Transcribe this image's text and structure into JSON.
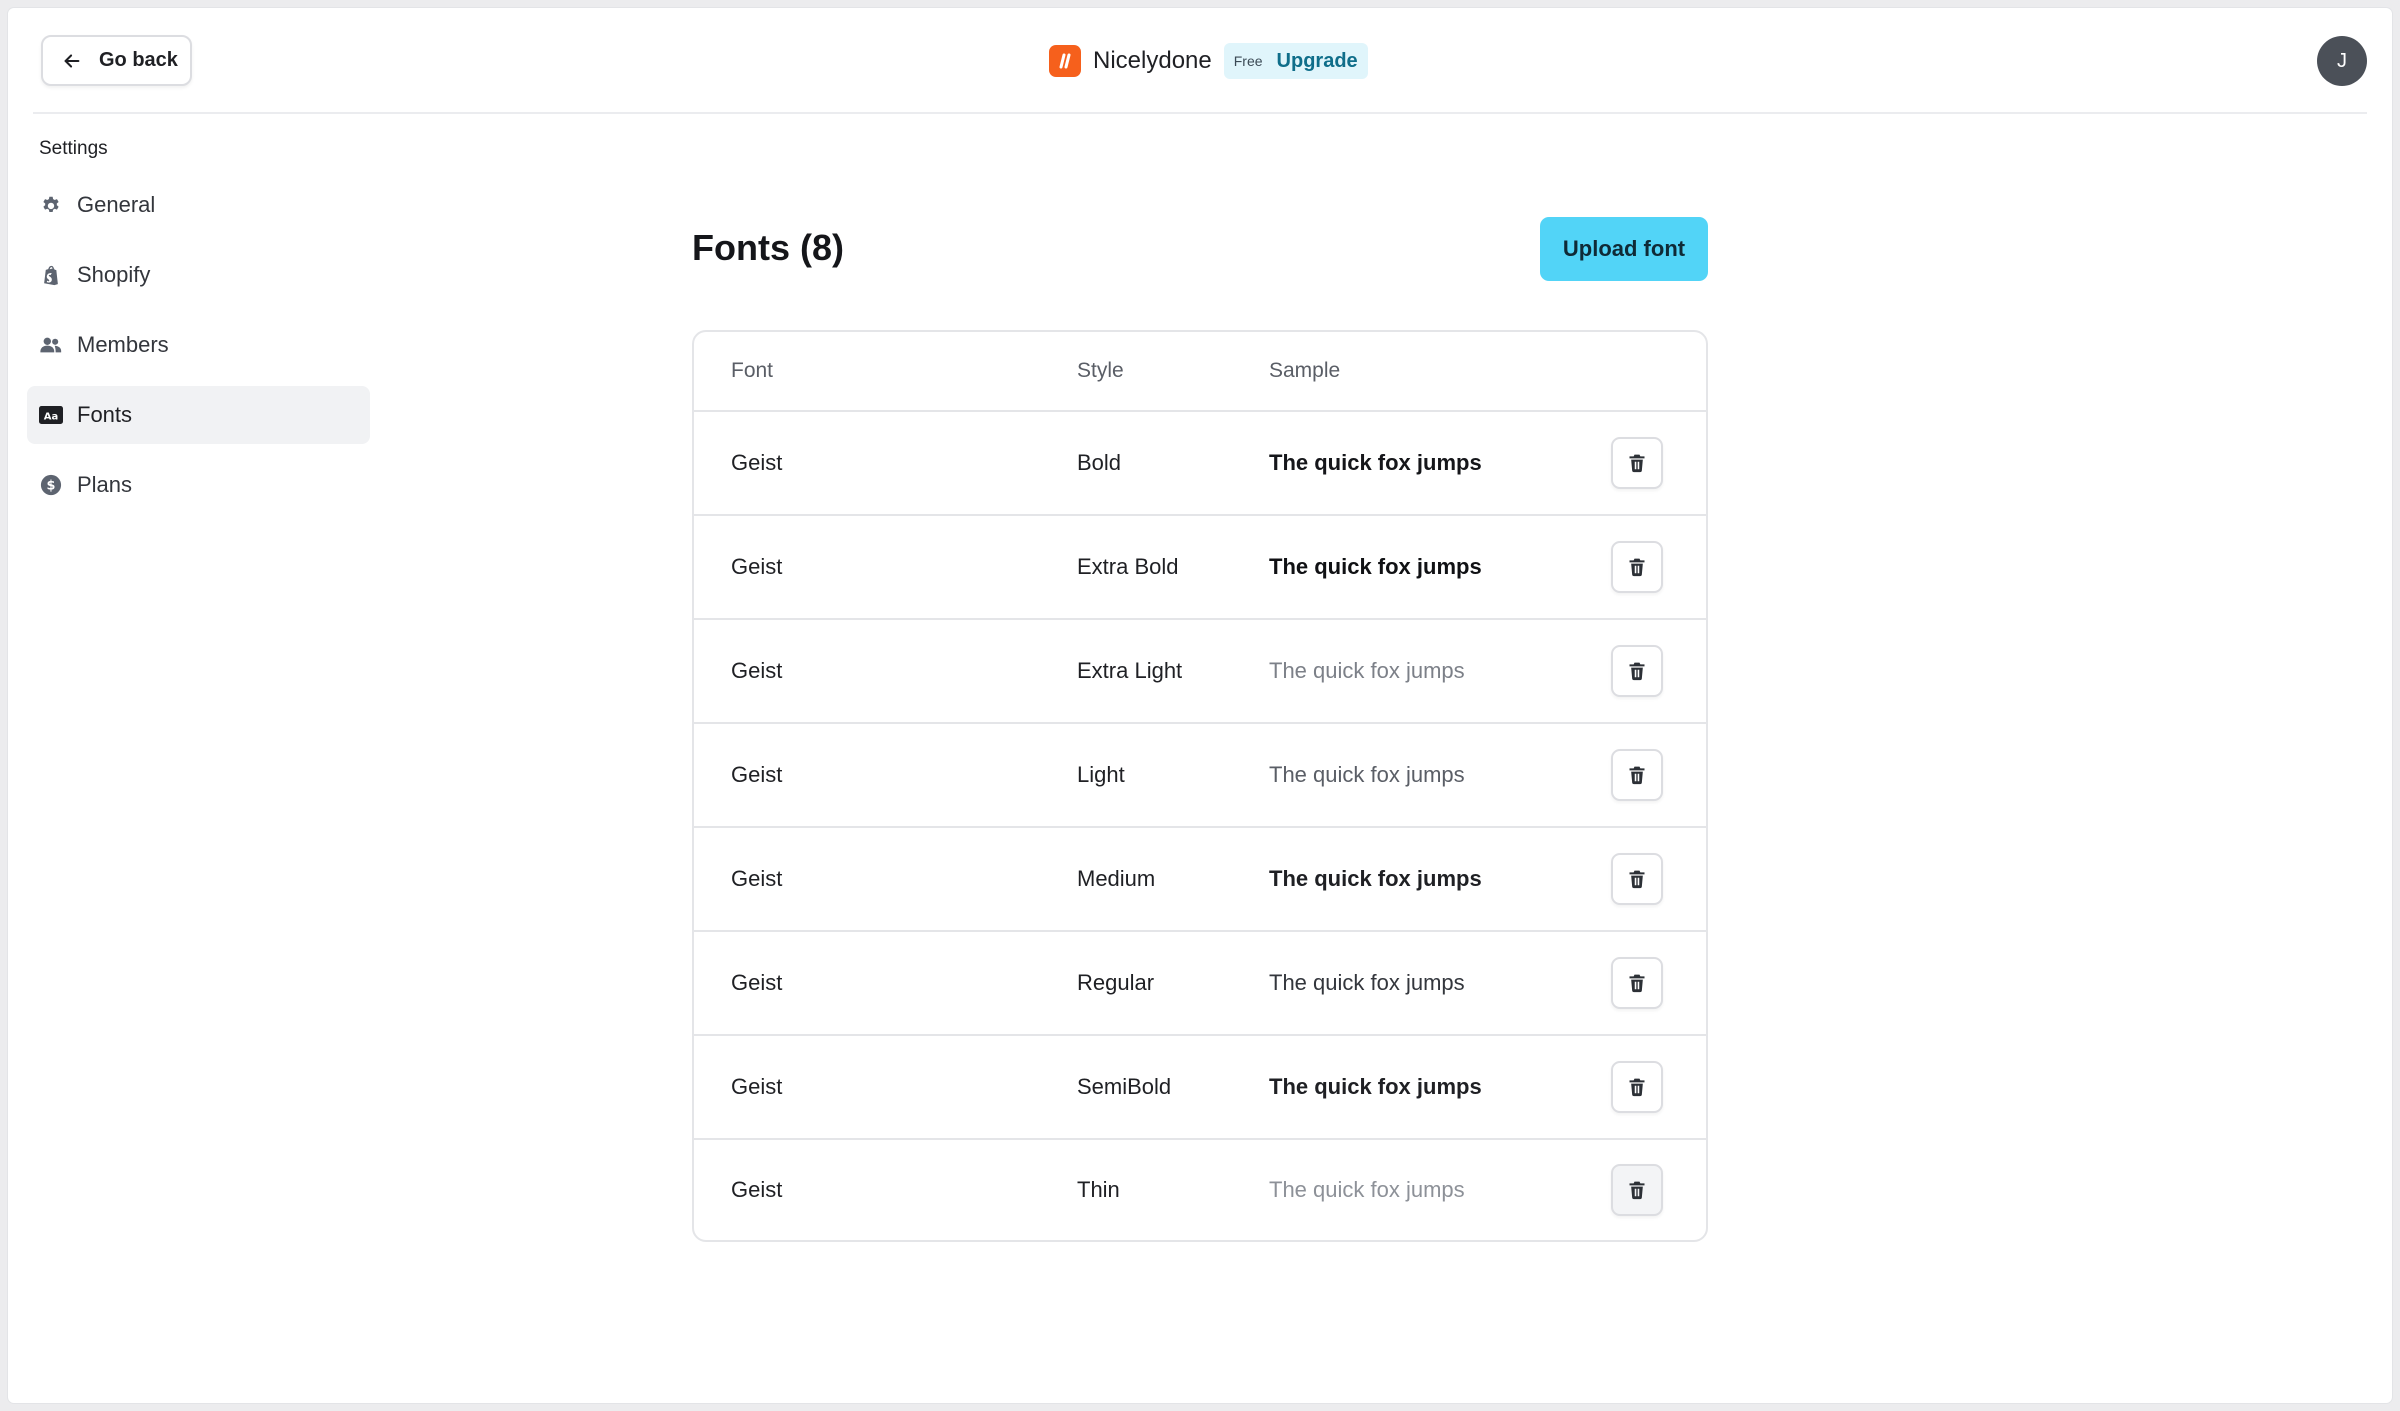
{
  "header": {
    "back_label": "Go back",
    "brand_name": "Nicelydone",
    "plan_badge": "Free",
    "upgrade_label": "Upgrade",
    "avatar_initial": "J",
    "brand_color": "#f6601c"
  },
  "sidebar": {
    "heading": "Settings",
    "items": [
      {
        "label": "General",
        "icon": "gear-icon"
      },
      {
        "label": "Shopify",
        "icon": "shopify-bag-icon"
      },
      {
        "label": "Members",
        "icon": "users-icon"
      },
      {
        "label": "Fonts",
        "icon": "font-aa-icon",
        "active": true
      },
      {
        "label": "Plans",
        "icon": "dollar-coin-icon"
      }
    ]
  },
  "main": {
    "title": "Fonts (8)",
    "upload_label": "Upload font",
    "accent_color": "#52d4f7",
    "table": {
      "headers": {
        "font": "Font",
        "style": "Style",
        "sample": "Sample"
      },
      "rows": [
        {
          "font": "Geist",
          "style": "Bold",
          "sample": "The quick fox jumps"
        },
        {
          "font": "Geist",
          "style": "Extra Bold",
          "sample": "The quick fox jumps"
        },
        {
          "font": "Geist",
          "style": "Extra Light",
          "sample": "The quick fox jumps"
        },
        {
          "font": "Geist",
          "style": "Light",
          "sample": "The quick fox jumps"
        },
        {
          "font": "Geist",
          "style": "Medium",
          "sample": "The quick fox jumps"
        },
        {
          "font": "Geist",
          "style": "Regular",
          "sample": "The quick fox jumps"
        },
        {
          "font": "Geist",
          "style": "SemiBold",
          "sample": "The quick fox jumps"
        },
        {
          "font": "Geist",
          "style": "Thin",
          "sample": "The quick fox jumps"
        }
      ]
    }
  }
}
